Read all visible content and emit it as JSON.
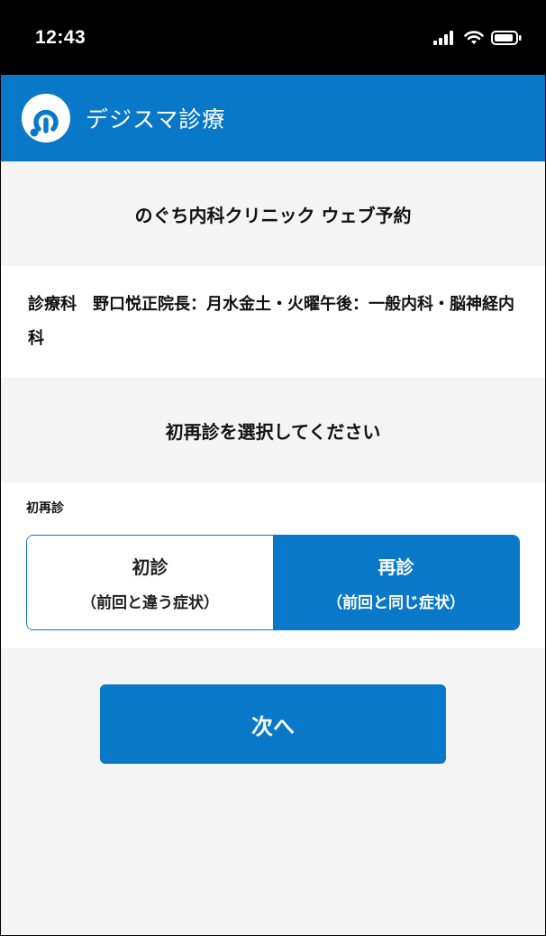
{
  "status_bar": {
    "time": "12:43"
  },
  "app": {
    "title": "デジスマ診療",
    "brand_color": "#0a78c8",
    "logo_icon": "stethoscope-logo-icon"
  },
  "clinic": {
    "title": "のぐち内科クリニック ウェブ予約"
  },
  "department": {
    "text": "診療科　野口悦正院長：月水金土・火曜午後：一般内科・脳神経内科"
  },
  "prompt": {
    "text": "初再診を選択してください"
  },
  "visit_type": {
    "label": "初再診",
    "selected": "再診",
    "options": [
      {
        "label": "初診",
        "sub": "（前回と違う症状）"
      },
      {
        "label": "再診",
        "sub": "（前回と同じ症状）"
      }
    ]
  },
  "next_button": {
    "label": "次へ"
  }
}
